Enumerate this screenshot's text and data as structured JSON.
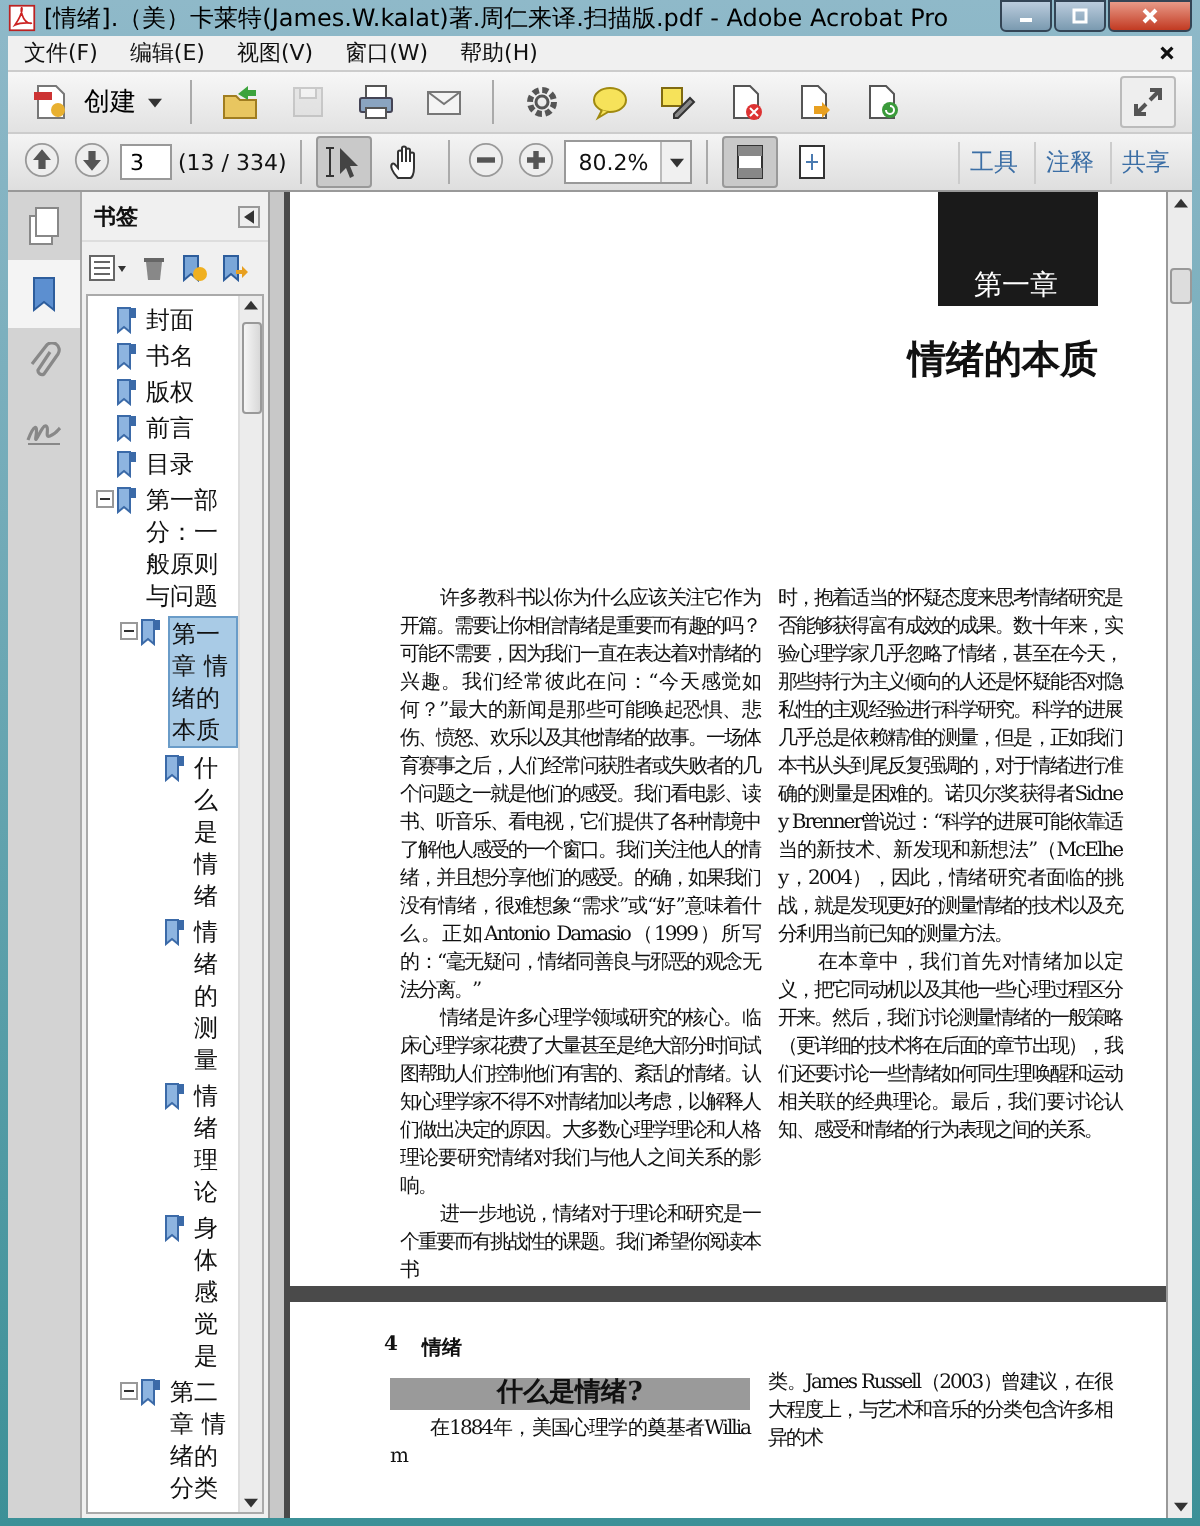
{
  "window": {
    "title": "[情绪].（美）卡莱特(James.W.kalat)著.周仁来译.扫描版.pdf - Adobe Acrobat Pro"
  },
  "menu": [
    "文件(F)",
    "编辑(E)",
    "视图(V)",
    "窗口(W)",
    "帮助(H)"
  ],
  "toolbar": {
    "create_label": "创建",
    "buttons": [
      {
        "kind": "open",
        "disabled": false
      },
      {
        "kind": "save",
        "disabled": true
      },
      {
        "kind": "print",
        "disabled": false
      },
      {
        "kind": "email",
        "disabled": false
      },
      {
        "kind": "settings",
        "disabled": false
      },
      {
        "kind": "comment",
        "disabled": false
      },
      {
        "kind": "highlight",
        "disabled": false
      },
      {
        "kind": "delete",
        "disabled": false
      },
      {
        "kind": "export",
        "disabled": false
      },
      {
        "kind": "refresh",
        "disabled": false
      }
    ]
  },
  "navigation": {
    "page_input": "3",
    "page_count": "(13 / 334)",
    "zoom": "80.2%",
    "tools": [
      {
        "kind": "select",
        "selected": true
      },
      {
        "kind": "hand",
        "selected": false
      }
    ],
    "views": [
      {
        "kind": "fit-page",
        "selected": true
      },
      {
        "kind": "fit-width",
        "selected": false
      }
    ]
  },
  "task_tabs": [
    "工具",
    "注释",
    "共享"
  ],
  "side_tabs": [
    {
      "kind": "pages",
      "selected": false
    },
    {
      "kind": "bookmarks",
      "selected": true
    },
    {
      "kind": "attachments",
      "selected": false
    },
    {
      "kind": "signatures",
      "selected": false
    }
  ],
  "bookmarks": {
    "title": "书签",
    "items": [
      {
        "label": "封面",
        "selected": false
      },
      {
        "label": "书名",
        "selected": false
      },
      {
        "label": "版权",
        "selected": false
      },
      {
        "label": "前言",
        "selected": false
      },
      {
        "label": "目录",
        "selected": false
      },
      {
        "label": "第一部分：一般原则与问题",
        "selected": false,
        "expanded": true,
        "children": [
          {
            "label": "第一章 情绪的本质",
            "selected": true,
            "expanded": true,
            "children": [
              {
                "label": "什么是情绪",
                "selected": false
              },
              {
                "label": "情绪的测量",
                "selected": false
              },
              {
                "label": "情绪理论",
                "selected": false
              },
              {
                "label": "身体感觉是",
                "selected": false
              }
            ]
          },
          {
            "label": "第二章 情绪的分类",
            "selected": false,
            "expanded": true
          }
        ]
      }
    ]
  },
  "document": {
    "page_1": {
      "chapter_label": "第一章",
      "chapter_title": "情绪的本质",
      "columns": [
        [
          "许多教科书以你为什么应该关注它作为开篇。需要让你相信情绪是重要而有趣的吗？可能不需要，因为我们一直在表达着对情绪的兴趣。我们经常彼此在问：“今天感觉如何？”最大的新闻是那些可能唤起恐惧、悲伤、愤怒、欢乐以及其他情绪的故事。一场体育赛事之后，人们经常问获胜者或失败者的几个问题之一就是他们的感受。我们看电影、读书、听音乐、看电视，它们提供了各种情境中了解他人感受的一个窗口。我们关注他人的情绪，并且想分享他们的感受。的确，如果我们没有情绪，很难想象“需求”或“好”意味着什么。正如Antonio Damasio（1999）所写的：“毫无疑问，情绪同善良与邪恶的观念无法分离。”",
          "情绪是许多心理学领域研究的核心。临床心理学家花费了大量甚至是绝大部分时间试图帮助人们控制他们有害的、紊乱的情绪。认知心理学家不得不对情绪加以考虑，以解释人们做出决定的原因。大多数心理学理论和人格理论要研究情绪对我们与他人之间关系的影响。",
          "进一步地说，情绪对于理论和研究是一个重要而有挑战性的课题。我们希望你阅读本书"
        ],
        [
          "时，抱着适当的怀疑态度来思考情绪研究是否能够获得富有成效的成果。数十年来，实验心理学家几乎忽略了情绪，甚至在今天，那些持行为主义倾向的人还是怀疑能否对隐私性的主观经验进行科学研究。科学的进展几乎总是依赖精准的测量，但是，正如我们本书从头到尾反复强调的，对于情绪进行准确的测量是困难的。诺贝尔奖获得者Sidney Brenner曾说过：“科学的进展可能依靠适当的新技术、新发现和新想法”（McElhey，2004），因此，情绪研究者面临的挑战，就是发现更好的测量情绪的技术以及充分利用当前已知的测量方法。",
          "在本章中，我们首先对情绪加以定义，把它同动机以及其他一些心理过程区分开来。然后，我们讨论测量情绪的一般策略（更详细的技术将在后面的章节出现），我们还要讨论一些情绪如何同生理唤醒和运动相关联的经典理论。最后，我们要讨论认知、感受和情绪的行为表现之间的关系。"
        ]
      ]
    },
    "page_2": {
      "page_number": "4",
      "running_head": "情绪",
      "section_heading": "什么是情绪?",
      "left_text": "在1884年，美国心理学的奠基者William",
      "right_text": "类。James Russell（2003）曾建议，在很大程度上，与艺术和音乐的分类包含许多相异的术"
    }
  }
}
